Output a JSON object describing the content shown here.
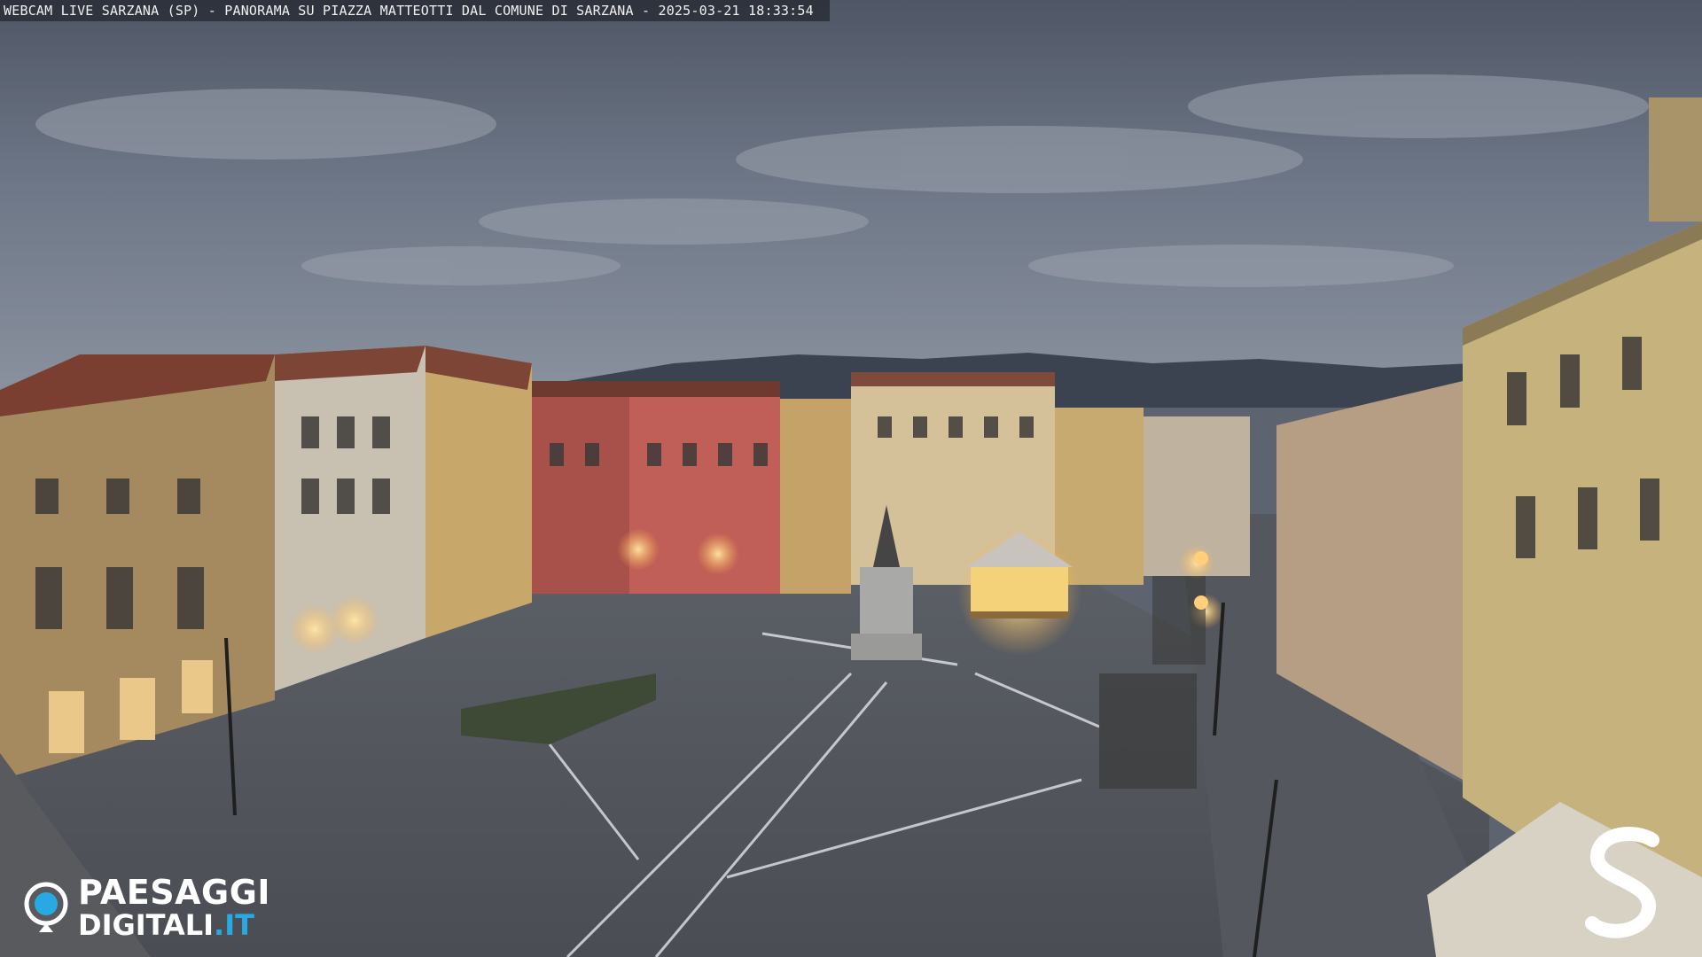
{
  "overlay": {
    "caption": "WEBCAM LIVE SARZANA (SP) - PANORAMA SU PIAZZA MATTEOTTI DAL COMUNE DI SARZANA - 2025-03-21  18:33:54"
  },
  "logo": {
    "line1": "PAESAGGI",
    "line2_main": "DIGITALI",
    "line2_accent": ".IT",
    "accent_color": "#29a9e1"
  },
  "corner_mark": {
    "letter": "S"
  },
  "scene": {
    "icons": [
      "webcam-panorama",
      "piazza",
      "carousel",
      "monument",
      "street-lamps"
    ]
  }
}
